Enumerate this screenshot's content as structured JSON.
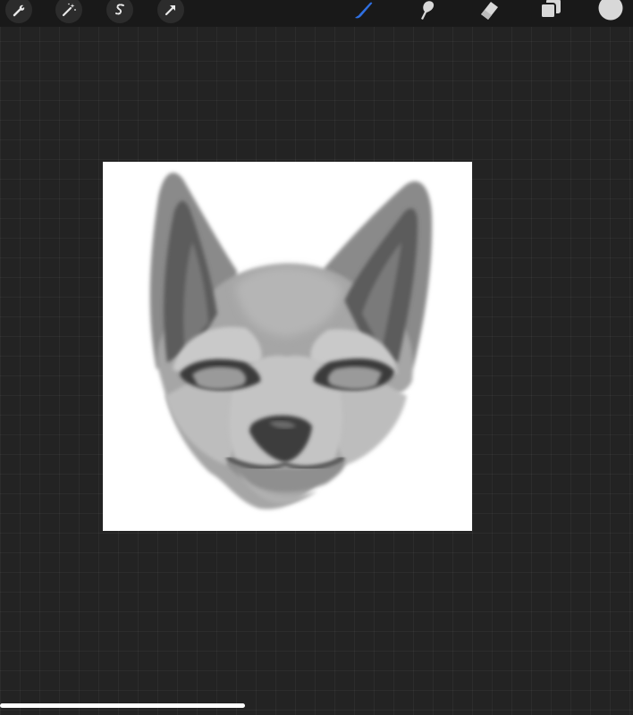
{
  "toolbar": {
    "left_tools": [
      {
        "name": "actions",
        "icon": "wrench-icon"
      },
      {
        "name": "adjustments",
        "icon": "magic-wand-icon"
      },
      {
        "name": "selection",
        "icon": "selection-s-icon"
      },
      {
        "name": "transform",
        "icon": "arrow-cursor-icon"
      }
    ],
    "right_tools": [
      {
        "name": "brush",
        "icon": "brush-icon",
        "active": true
      },
      {
        "name": "smudge",
        "icon": "smudge-icon"
      },
      {
        "name": "eraser",
        "icon": "eraser-icon"
      },
      {
        "name": "layers",
        "icon": "layers-icon"
      },
      {
        "name": "color",
        "icon": "color-swatch-icon"
      }
    ],
    "active_color": "#2f6fe0",
    "current_color": "#d8d8d8"
  },
  "canvas": {
    "subject": "fox-head-sketch",
    "background": "#ffffff"
  }
}
